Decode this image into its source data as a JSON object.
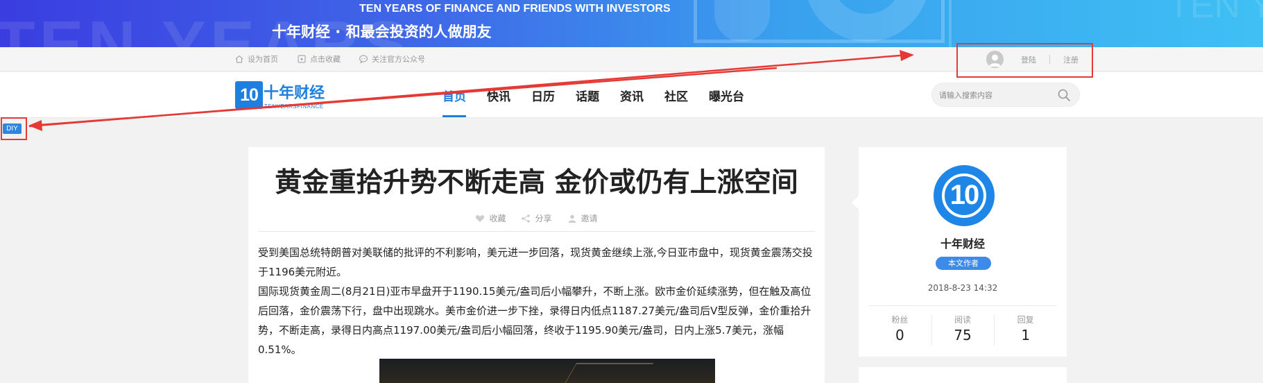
{
  "banner": {
    "ghost_text": "TEN YEARS",
    "ghost_right": "TEN Y",
    "slogan_en": "TEN YEARS OF FINANCE AND FRIENDS WITH  INVESTORS",
    "slogan_cn": "十年财经 · 和最会投资的人做朋友"
  },
  "util_bar": {
    "set_home": "设为首页",
    "bookmark": "点击收藏",
    "follow_wechat": "关注官方公众号",
    "login": "登陆",
    "register": "注册"
  },
  "nav": {
    "logo_name": "十年财经",
    "logo_mark": "10",
    "logo_sub": "TENYEARSFINANCE",
    "items": [
      {
        "label": "首页",
        "active": true
      },
      {
        "label": "快讯",
        "active": false
      },
      {
        "label": "日历",
        "active": false
      },
      {
        "label": "话题",
        "active": false
      },
      {
        "label": "资讯",
        "active": false
      },
      {
        "label": "社区",
        "active": false
      },
      {
        "label": "曝光台",
        "active": false
      }
    ],
    "search_placeholder": "请输入搜索内容"
  },
  "diy_tag": "DIY",
  "article": {
    "title": "黄金重拾升势不断走高 金价或仍有上涨空间",
    "actions": {
      "favorite": "收藏",
      "share": "分享",
      "invite": "邀请"
    },
    "paragraphs": [
      "受到美国总统特朗普对美联储的批评的不利影响，美元进一步回落，现货黄金继续上涨,今日亚市盘中，现货黄金震荡交投于1196美元附近。",
      "国际现货黄金周二(8月21日)亚市早盘开于1190.15美元/盎司后小幅攀升，不断上涨。欧市金价延续涨势，但在触及高位后回落，金价震荡下行，盘中出现跳水。美市金价进一步下挫，录得日内低点1187.27美元/盎司后V型反弹，金价重拾升势，不断走高，录得日内高点1197.00美元/盎司后小幅回落，终收于1195.90美元/盎司，日内上涨5.7美元，涨幅0.51%。"
    ]
  },
  "author": {
    "avatar_text": "10",
    "name": "十年财经",
    "badge": "本文作者",
    "date": "2018-8-23 14:32",
    "stats": [
      {
        "label": "粉丝",
        "value": "0"
      },
      {
        "label": "阅读",
        "value": "75"
      },
      {
        "label": "回复",
        "value": "1"
      }
    ]
  },
  "colors": {
    "brand_blue": "#1d7fe0",
    "annotation_red": "#e53935",
    "badge_blue": "#3d8be8"
  }
}
